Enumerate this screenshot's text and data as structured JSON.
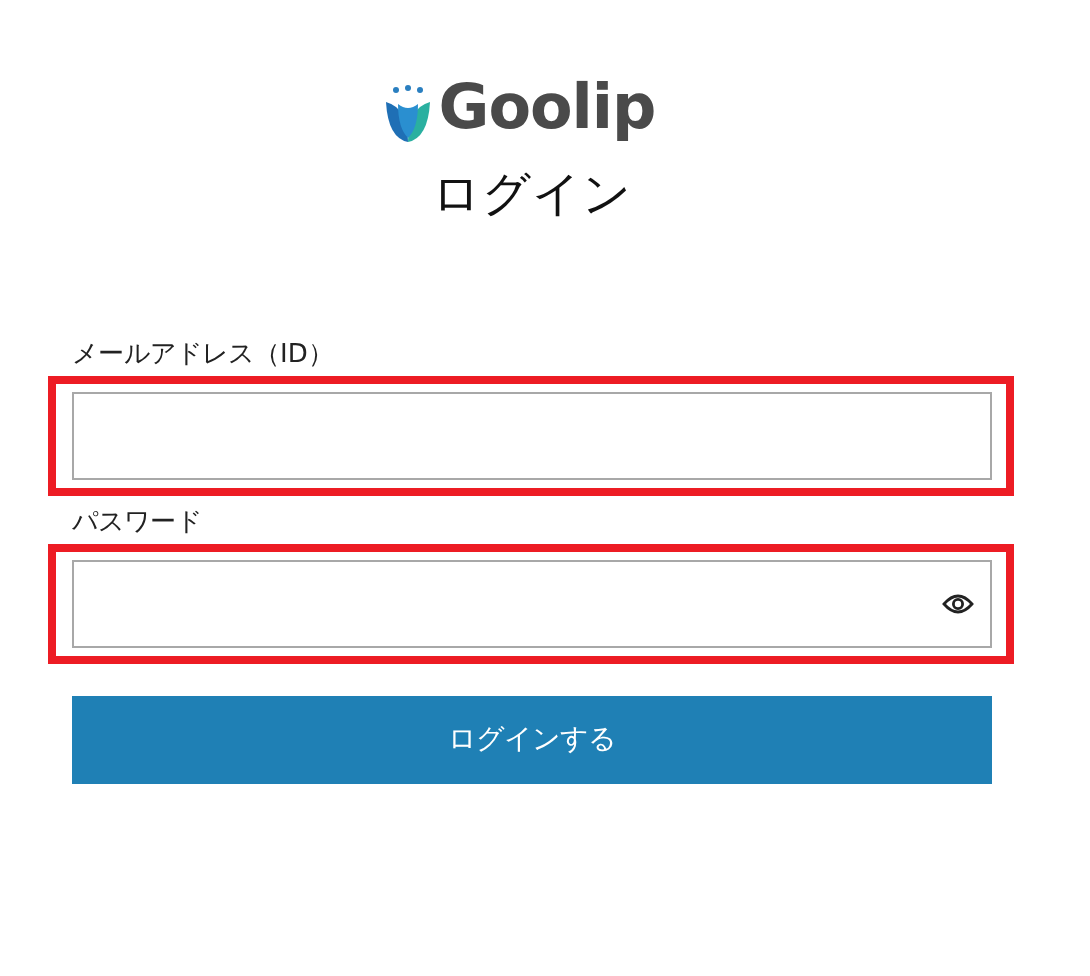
{
  "logo": {
    "text": "Goolip"
  },
  "title": "ログイン",
  "fields": [
    {
      "label": "メールアドレス（ID）",
      "kind": "text",
      "highlighted": true
    },
    {
      "label": "パスワード",
      "kind": "password",
      "highlighted": true
    }
  ],
  "submit_button": "ログインする"
}
